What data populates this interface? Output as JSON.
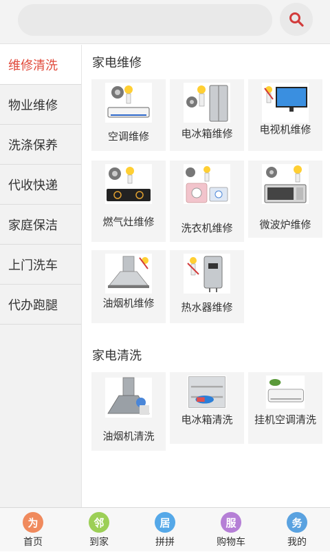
{
  "search": {
    "placeholder": ""
  },
  "sidebar": {
    "items": [
      {
        "label": "维修清洗",
        "active": true
      },
      {
        "label": "物业维修"
      },
      {
        "label": "洗涤保养"
      },
      {
        "label": "代收快递"
      },
      {
        "label": "家庭保洁"
      },
      {
        "label": "上门洗车"
      },
      {
        "label": "代办跑腿"
      }
    ]
  },
  "sections": [
    {
      "title": "家电维修",
      "items": [
        {
          "label": "空调维修",
          "icon": "ac-repair-icon"
        },
        {
          "label": "电冰箱维修",
          "icon": "fridge-repair-icon"
        },
        {
          "label": "电视机维修",
          "icon": "tv-repair-icon"
        },
        {
          "label": "燃气灶维修",
          "icon": "gas-stove-repair-icon"
        },
        {
          "label": "洗衣机维修",
          "icon": "washer-repair-icon"
        },
        {
          "label": "微波炉维修",
          "icon": "microwave-repair-icon"
        },
        {
          "label": "油烟机维修",
          "icon": "range-hood-repair-icon"
        },
        {
          "label": "热水器维修",
          "icon": "water-heater-repair-icon"
        }
      ]
    },
    {
      "title": "家电清洗",
      "items": [
        {
          "label": "油烟机清洗",
          "icon": "range-hood-clean-icon"
        },
        {
          "label": "电冰箱清洗",
          "icon": "fridge-clean-icon"
        },
        {
          "label": "挂机空调清洗",
          "icon": "ac-clean-icon"
        }
      ]
    }
  ],
  "footer": {
    "tabs": [
      {
        "label": "首页",
        "badge": "为",
        "color": "#f08a5d"
      },
      {
        "label": "到家",
        "badge": "邻",
        "color": "#9ccf56"
      },
      {
        "label": "拼拼",
        "badge": "居",
        "color": "#55a8e8"
      },
      {
        "label": "购物车",
        "badge": "服",
        "color": "#b57fd6"
      },
      {
        "label": "我的",
        "badge": "务",
        "color": "#5aa2e0"
      }
    ]
  },
  "colors": {
    "accent": "#e0493a",
    "search_icon": "#d23b3b"
  }
}
